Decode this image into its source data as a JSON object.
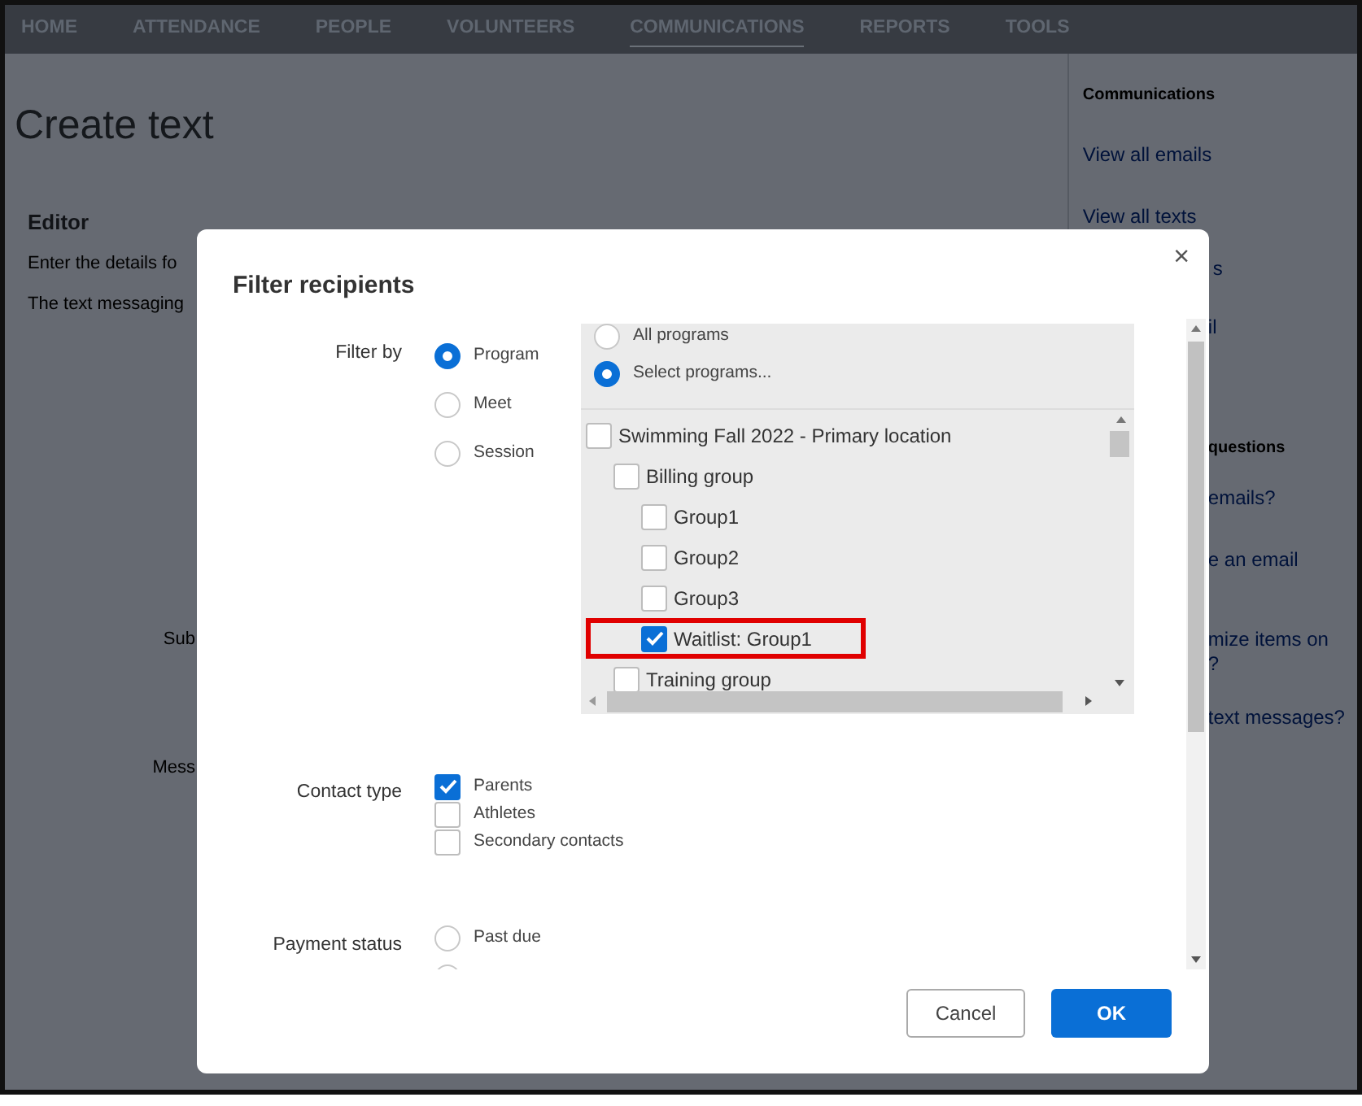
{
  "nav": {
    "items": [
      {
        "label": "HOME",
        "selected": false
      },
      {
        "label": "ATTENDANCE",
        "selected": false
      },
      {
        "label": "PEOPLE",
        "selected": false
      },
      {
        "label": "VOLUNTEERS",
        "selected": false
      },
      {
        "label": "COMMUNICATIONS",
        "selected": true
      },
      {
        "label": "REPORTS",
        "selected": false
      },
      {
        "label": "TOOLS",
        "selected": false
      }
    ]
  },
  "page": {
    "title": "Create text",
    "section": "Editor",
    "lines": [
      "Enter the details fo",
      "The text messaging"
    ],
    "field_labels": [
      "Sub",
      "Mess"
    ]
  },
  "sidebar": {
    "heading": "Communications",
    "links": [
      "View all emails",
      "View all texts"
    ],
    "fragments": [
      {
        "text": "s",
        "kind": "link"
      },
      {
        "text": "il",
        "kind": "link"
      },
      {
        "text": "questions",
        "kind": "heading"
      },
      {
        "text": "emails?",
        "kind": "link"
      },
      {
        "text": "e an email",
        "kind": "link"
      },
      {
        "text": "mize items on",
        "kind": "link"
      },
      {
        "text": "?",
        "kind": "link"
      },
      {
        "text": "text messages?",
        "kind": "link"
      }
    ]
  },
  "dialog": {
    "title": "Filter recipients",
    "close": "×",
    "filter_by": {
      "label": "Filter by",
      "options": [
        {
          "label": "Program",
          "selected": true
        },
        {
          "label": "Meet",
          "selected": false
        },
        {
          "label": "Session",
          "selected": false
        }
      ]
    },
    "program_scope": [
      {
        "label": "All programs",
        "selected": false
      },
      {
        "label": "Select programs...",
        "selected": true
      }
    ],
    "program_tree": [
      {
        "label": "Swimming Fall 2022 - Primary location",
        "checked": false,
        "children": [
          {
            "label": "Billing group",
            "checked": false,
            "children": [
              {
                "label": "Group1",
                "checked": false
              },
              {
                "label": "Group2",
                "checked": false
              },
              {
                "label": "Group3",
                "checked": false
              },
              {
                "label": "Waitlist: Group1",
                "checked": true,
                "highlighted": true
              }
            ]
          },
          {
            "label": "Training group",
            "checked": false
          }
        ]
      }
    ],
    "contact_type": {
      "label": "Contact type",
      "options": [
        {
          "label": "Parents",
          "checked": true
        },
        {
          "label": "Athletes",
          "checked": false
        },
        {
          "label": "Secondary contacts",
          "checked": false
        }
      ]
    },
    "payment_status": {
      "label": "Payment status",
      "options": [
        {
          "label": "Past due",
          "selected": false
        },
        {
          "selected": false
        }
      ]
    },
    "buttons": [
      {
        "label": "Cancel",
        "kind": "secondary"
      },
      {
        "label": "OK",
        "kind": "primary"
      }
    ]
  }
}
